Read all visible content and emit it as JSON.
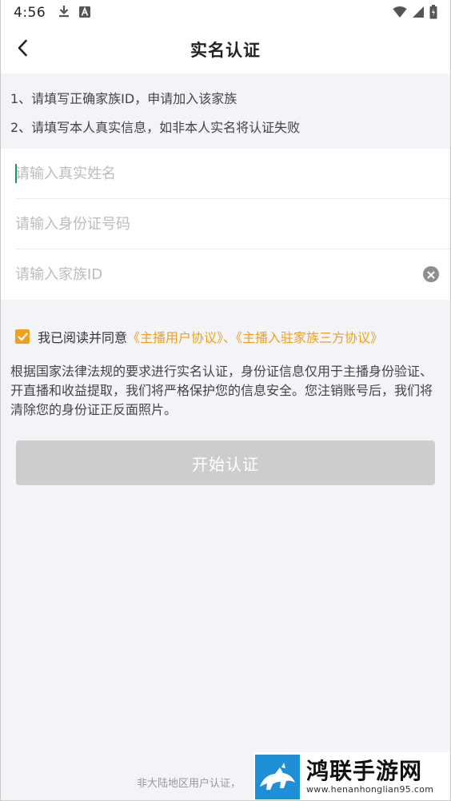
{
  "status_bar": {
    "time": "4:56",
    "left_icons": [
      "download-icon",
      "font-a-icon"
    ],
    "right_icons": [
      "wifi-icon",
      "signal-icon",
      "battery-icon"
    ]
  },
  "nav": {
    "title": "实名认证",
    "back_icon": "chevron-left-icon"
  },
  "notice": {
    "line1": "1、请填写正确家族ID，申请加入该家族",
    "line2": "2、请填写本人真实信息，如非本人实名将认证失败"
  },
  "form": {
    "name_placeholder": "请输入真实姓名",
    "name_value": "",
    "id_placeholder": "请输入身份证号码",
    "id_value": "",
    "family_placeholder": "请输入家族ID",
    "family_value": ""
  },
  "agreement": {
    "checked": true,
    "prefix": "我已阅读并同意",
    "link1": "《主播用户协议》",
    "separator": "、",
    "link2": "《主播入驻家族三方协议》"
  },
  "description": "根据国家法律法规的要求进行实名认证，身份证信息仅用于主播身份验证、开直播和收益提取，我们将严格保护您的信息安全。您注销账号后，我们将清除您的身份证正反面照片。",
  "start_button": {
    "label": "开始认证",
    "enabled": false
  },
  "footer": {
    "text": "非大陆地区用户认证，"
  },
  "watermark": {
    "title": "鸿联手游网",
    "url": "www.henanhonglian95.com"
  },
  "colors": {
    "accent": "#f0a020",
    "background": "#f3f4f8",
    "button_disabled": "#cdcdcd",
    "caret": "#1e8f6e"
  }
}
